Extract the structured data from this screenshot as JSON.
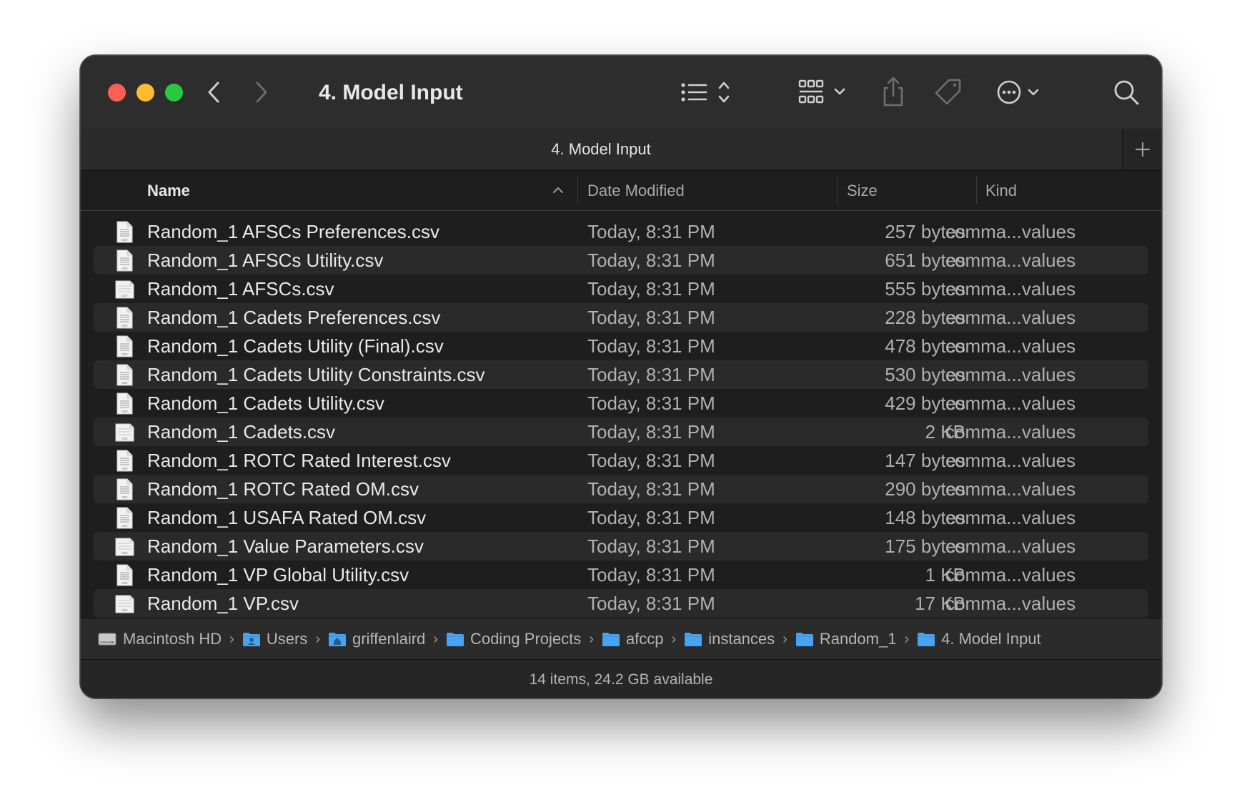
{
  "window": {
    "title": "4. Model Input"
  },
  "toolbar": {
    "back_icon": "chevron-left-icon",
    "forward_icon": "chevron-right-icon",
    "view_icon": "list-view-icon",
    "group_icon": "grid-view-icon",
    "share_icon": "share-icon",
    "tag_icon": "tag-icon",
    "action_icon": "ellipsis-circle-icon",
    "search_icon": "search-icon"
  },
  "tab": {
    "label": "4. Model Input",
    "add_icon": "plus-icon"
  },
  "columns": {
    "name": "Name",
    "date": "Date Modified",
    "size": "Size",
    "kind": "Kind"
  },
  "files": [
    {
      "name": "Random_1 AFSCs Preferences.csv",
      "date": "Today, 8:31 PM",
      "size": "257 bytes",
      "kind": "comma...values",
      "icon": "csv-doc"
    },
    {
      "name": "Random_1 AFSCs Utility.csv",
      "date": "Today, 8:31 PM",
      "size": "651 bytes",
      "kind": "comma...values",
      "icon": "csv-doc"
    },
    {
      "name": "Random_1 AFSCs.csv",
      "date": "Today, 8:31 PM",
      "size": "555 bytes",
      "kind": "comma...values",
      "icon": "csv-sheet"
    },
    {
      "name": "Random_1 Cadets Preferences.csv",
      "date": "Today, 8:31 PM",
      "size": "228 bytes",
      "kind": "comma...values",
      "icon": "csv-doc"
    },
    {
      "name": "Random_1 Cadets Utility (Final).csv",
      "date": "Today, 8:31 PM",
      "size": "478 bytes",
      "kind": "comma...values",
      "icon": "csv-doc"
    },
    {
      "name": "Random_1 Cadets Utility Constraints.csv",
      "date": "Today, 8:31 PM",
      "size": "530 bytes",
      "kind": "comma...values",
      "icon": "csv-doc"
    },
    {
      "name": "Random_1 Cadets Utility.csv",
      "date": "Today, 8:31 PM",
      "size": "429 bytes",
      "kind": "comma...values",
      "icon": "csv-doc"
    },
    {
      "name": "Random_1 Cadets.csv",
      "date": "Today, 8:31 PM",
      "size": "2 KB",
      "kind": "comma...values",
      "icon": "csv-sheet"
    },
    {
      "name": "Random_1 ROTC Rated Interest.csv",
      "date": "Today, 8:31 PM",
      "size": "147 bytes",
      "kind": "comma...values",
      "icon": "csv-doc"
    },
    {
      "name": "Random_1 ROTC Rated OM.csv",
      "date": "Today, 8:31 PM",
      "size": "290 bytes",
      "kind": "comma...values",
      "icon": "csv-doc"
    },
    {
      "name": "Random_1 USAFA Rated OM.csv",
      "date": "Today, 8:31 PM",
      "size": "148 bytes",
      "kind": "comma...values",
      "icon": "csv-doc"
    },
    {
      "name": "Random_1 Value Parameters.csv",
      "date": "Today, 8:31 PM",
      "size": "175 bytes",
      "kind": "comma...values",
      "icon": "csv-sheet"
    },
    {
      "name": "Random_1 VP Global Utility.csv",
      "date": "Today, 8:31 PM",
      "size": "1 KB",
      "kind": "comma...values",
      "icon": "csv-doc"
    },
    {
      "name": "Random_1 VP.csv",
      "date": "Today, 8:31 PM",
      "size": "17 KB",
      "kind": "comma...values",
      "icon": "csv-sheet"
    }
  ],
  "pathbar": [
    {
      "label": "Macintosh HD",
      "icon": "hard-drive-icon"
    },
    {
      "label": "Users",
      "icon": "users-folder-icon"
    },
    {
      "label": "griffenlaird",
      "icon": "home-folder-icon"
    },
    {
      "label": "Coding Projects",
      "icon": "folder-icon"
    },
    {
      "label": "afccp",
      "icon": "folder-icon"
    },
    {
      "label": "instances",
      "icon": "folder-icon"
    },
    {
      "label": "Random_1",
      "icon": "folder-icon"
    },
    {
      "label": "4. Model Input",
      "icon": "folder-icon"
    }
  ],
  "status": {
    "text": "14 items, 24.2 GB available"
  },
  "colors": {
    "folder": "#4aa3ef",
    "accent": "#0a84ff"
  }
}
